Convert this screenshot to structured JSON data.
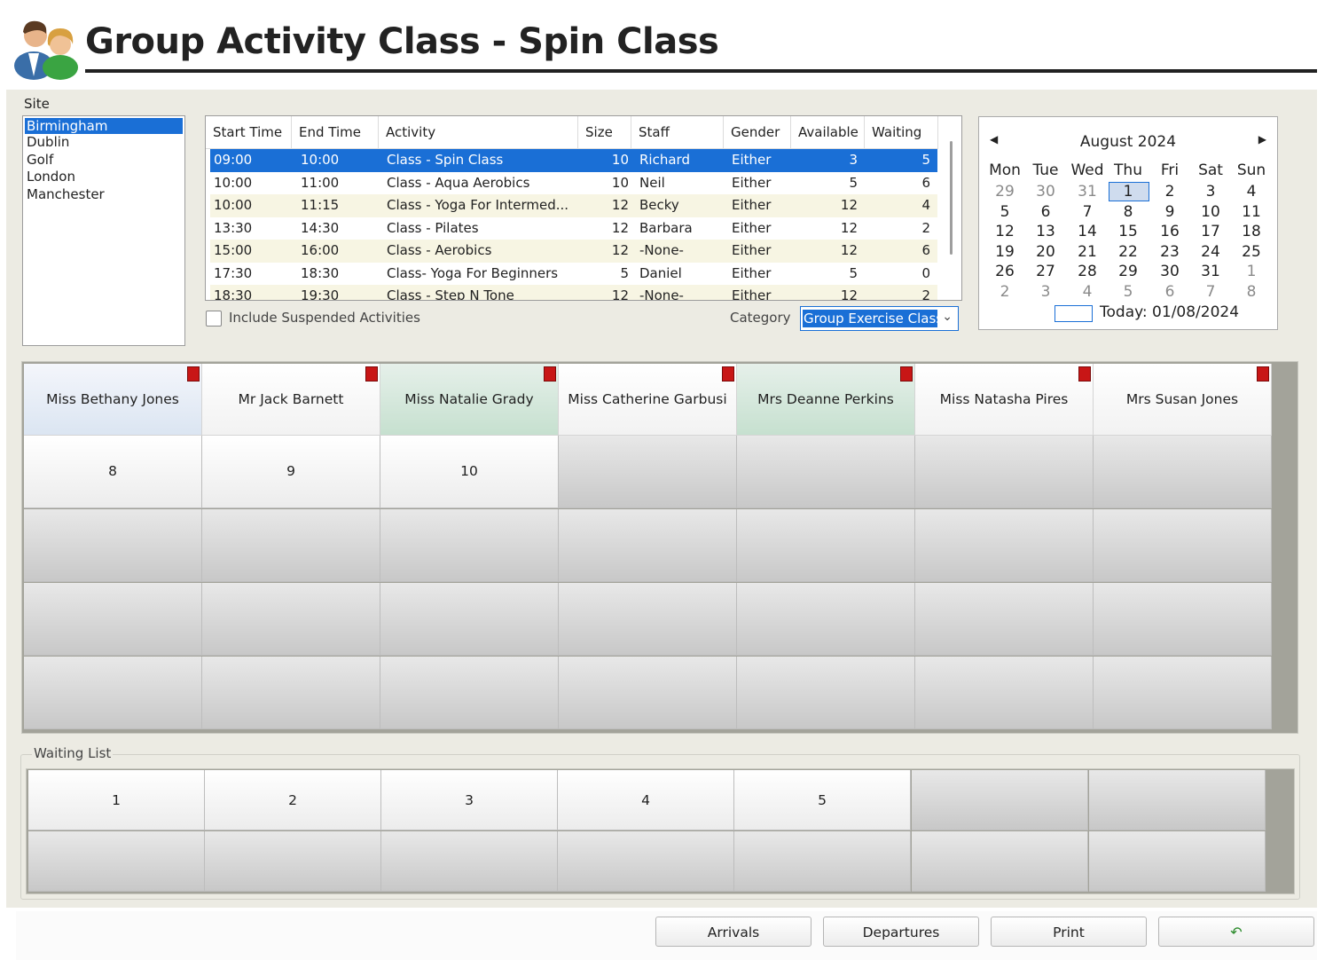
{
  "header": {
    "title": "Group Activity Class - Spin Class",
    "icon": "users-icon"
  },
  "site": {
    "label": "Site",
    "items": [
      "Birmingham",
      "Dublin",
      "Golf",
      "London",
      "Manchester"
    ],
    "selected": "Birmingham"
  },
  "activities": {
    "columns": [
      "Start Time",
      "End Time",
      "Activity",
      "Size",
      "Staff",
      "Gender",
      "Available",
      "Waiting"
    ],
    "rows": [
      {
        "start": "09:00",
        "end": "10:00",
        "activity": "Class - Spin Class",
        "size": "10",
        "staff": "Richard",
        "gender": "Either",
        "available": "3",
        "waiting": "5",
        "selected": true
      },
      {
        "start": "10:00",
        "end": "11:00",
        "activity": "Class - Aqua Aerobics",
        "size": "10",
        "staff": "Neil",
        "gender": "Either",
        "available": "5",
        "waiting": "6"
      },
      {
        "start": "10:00",
        "end": "11:15",
        "activity": "Class - Yoga For Intermed...",
        "size": "12",
        "staff": "Becky",
        "gender": "Either",
        "available": "12",
        "waiting": "4"
      },
      {
        "start": "13:30",
        "end": "14:30",
        "activity": "Class - Pilates",
        "size": "12",
        "staff": "Barbara",
        "gender": "Either",
        "available": "12",
        "waiting": "2"
      },
      {
        "start": "15:00",
        "end": "16:00",
        "activity": "Class - Aerobics",
        "size": "12",
        "staff": "-None-",
        "gender": "Either",
        "available": "12",
        "waiting": "6"
      },
      {
        "start": "17:30",
        "end": "18:30",
        "activity": "Class- Yoga For Beginners",
        "size": "5",
        "staff": "Daniel",
        "gender": "Either",
        "available": "5",
        "waiting": "0"
      },
      {
        "start": "18:30",
        "end": "19:30",
        "activity": "Class - Step N Tone",
        "size": "12",
        "staff": "-None-",
        "gender": "Either",
        "available": "12",
        "waiting": "2"
      }
    ]
  },
  "filters": {
    "include_suspended": "Include Suspended Activities",
    "category_label": "Category",
    "category_value": "Group Exercise Class"
  },
  "calendar": {
    "month": "August 2024",
    "days": [
      "Mon",
      "Tue",
      "Wed",
      "Thu",
      "Fri",
      "Sat",
      "Sun"
    ],
    "weeks": [
      [
        [
          "29",
          1
        ],
        [
          "30",
          1
        ],
        [
          "31",
          1
        ],
        [
          "1",
          0
        ],
        [
          "2",
          0
        ],
        [
          "3",
          0
        ],
        [
          "4",
          0
        ]
      ],
      [
        [
          "5",
          0
        ],
        [
          "6",
          0
        ],
        [
          "7",
          0
        ],
        [
          "8",
          0
        ],
        [
          "9",
          0
        ],
        [
          "10",
          0
        ],
        [
          "11",
          0
        ]
      ],
      [
        [
          "12",
          0
        ],
        [
          "13",
          0
        ],
        [
          "14",
          0
        ],
        [
          "15",
          0
        ],
        [
          "16",
          0
        ],
        [
          "17",
          0
        ],
        [
          "18",
          0
        ]
      ],
      [
        [
          "19",
          0
        ],
        [
          "20",
          0
        ],
        [
          "21",
          0
        ],
        [
          "22",
          0
        ],
        [
          "23",
          0
        ],
        [
          "24",
          0
        ],
        [
          "25",
          0
        ]
      ],
      [
        [
          "26",
          0
        ],
        [
          "27",
          0
        ],
        [
          "28",
          0
        ],
        [
          "29",
          0
        ],
        [
          "30",
          0
        ],
        [
          "31",
          0
        ],
        [
          "1",
          1
        ]
      ],
      [
        [
          "2",
          1
        ],
        [
          "3",
          1
        ],
        [
          "4",
          1
        ],
        [
          "5",
          1
        ],
        [
          "6",
          1
        ],
        [
          "7",
          1
        ],
        [
          "8",
          1
        ]
      ]
    ],
    "selected_day": "1",
    "today": "Today: 01/08/2024"
  },
  "attendees": {
    "headers": [
      {
        "name": "Miss Bethany Jones",
        "style": "blue"
      },
      {
        "name": "Mr Jack Barnett",
        "style": "white"
      },
      {
        "name": "Miss Natalie Grady",
        "style": "green"
      },
      {
        "name": "Miss Catherine Garbusi",
        "style": "white"
      },
      {
        "name": "Mrs Deanne Perkins",
        "style": "green"
      },
      {
        "name": "Miss Natasha Pires",
        "style": "white"
      },
      {
        "name": "Mrs Susan Jones",
        "style": "white"
      }
    ],
    "rows": [
      [
        "8",
        "9",
        "10",
        "",
        "",
        "",
        ""
      ],
      [
        "",
        "",
        "",
        "",
        "",
        "",
        ""
      ],
      [
        "",
        "",
        "",
        "",
        "",
        "",
        ""
      ],
      [
        "",
        "",
        "",
        "",
        "",
        "",
        ""
      ]
    ]
  },
  "waiting_list": {
    "label": "Waiting List",
    "rows": [
      [
        "1",
        "2",
        "3",
        "4",
        "5",
        "",
        ""
      ],
      [
        "",
        "",
        "",
        "",
        "",
        "",
        ""
      ]
    ]
  },
  "footer": {
    "buttons": [
      "Arrivals",
      "Departures",
      "Print"
    ],
    "undo_icon": "undo-icon"
  },
  "colors": {
    "selection": "#1a6fd6",
    "book_icon": "#c81616",
    "panel": "#ecebe3"
  }
}
